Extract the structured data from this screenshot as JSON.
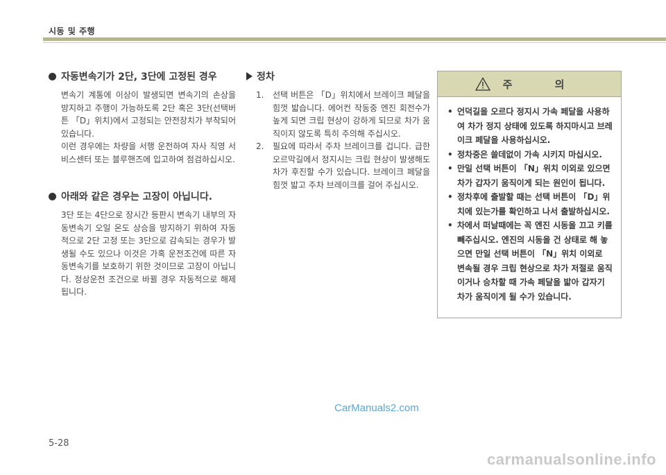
{
  "header": {
    "title": "시동 및 주행"
  },
  "left": {
    "section1": {
      "title": "자동변속기가 2단, 3단에 고정된 경우",
      "paragraphs": [
        "변속기 계통에 이상이 발생되면 변속기의 손상을 방지하고 주행이 가능하도록 2단 혹은 3단(선택버튼 「D」위치)에서 고정되는 안전장치가 부착되어 있습니다.",
        "이런 경우에는 차량을 서행 운전하여 자사 직영 서비스센터 또는 블루핸즈에 입고하여 점검하십시오."
      ]
    },
    "section2": {
      "title": "아래와 같은 경우는 고장이 아닙니다.",
      "paragraph": "3단 또는 4단으로 장시간 등판시 변속기 내부의 자동변속기 오일 온도 상승을 방지하기 위하여 자동적으로 2단 고정 또는 3단으로 감속되는 경우가 발생될 수도 있으나 이것은 가혹 운전조건에 따른 자동변속기를 보호하기 위한 것이므로 고장이 아닙니다. 정상운전 조건으로 바뀔 경우 자동적으로 해제됩니다."
    }
  },
  "middle": {
    "title": "정차",
    "items": [
      {
        "num": "1.",
        "text": "선택 버튼은 「D」위치에서 브레이크 페달을 힘껏 밟습니다. 에어컨 작동중 엔진 회전수가 높게 되면 크립 현상이 강하게 되므로 차가 움직이지 않도록 특히 주의해 주십시오."
      },
      {
        "num": "2.",
        "text": "필요에 따라서 주차 브레이크를 겁니다. 급한 오르막길에서 정지시는 크립 현상이 발생해도 차가 후진할 수가 있습니다. 브레이크 페달을 힘껏 밟고 주차 브레이크를 걸어 주십시오."
      }
    ]
  },
  "caution": {
    "title": "주 의",
    "bullet": "•",
    "items": [
      "언덕길을 오르다 정지시 가속 페달을 사용하여 차가 정지 상태에 있도록 하지마시고 브레이크 페달을 사용하십시오.",
      "정차중은 쓸데없이 가속 시키지 마십시오.",
      "만일 선택 버튼이 「N」위치 이외로 있으면 차가 갑자기 움직이게 되는 원인이 됩니다.",
      "정차후에 출발할 때는 선택 버튼이 「D」위치에 있는가를 확인하고 나서 출발하십시오.",
      "차에서 떠날때에는 꼭 엔진 시동을 끄고 키를 빼주십시오. 엔진의 시동을 건 상태로 해 놓으면 만일 선택 버튼이 「N」위치 이외로 변속될 경우 크립 현상으로 차가 저절로 움직이거나 승차할 때 가속 페달을 밟아 갑자기 차가 움직이게 될 수가 있습니다."
    ]
  },
  "watermark": "CarManuals2.com",
  "page_number": "5-28",
  "footer_url": "carmanualsonline.info"
}
